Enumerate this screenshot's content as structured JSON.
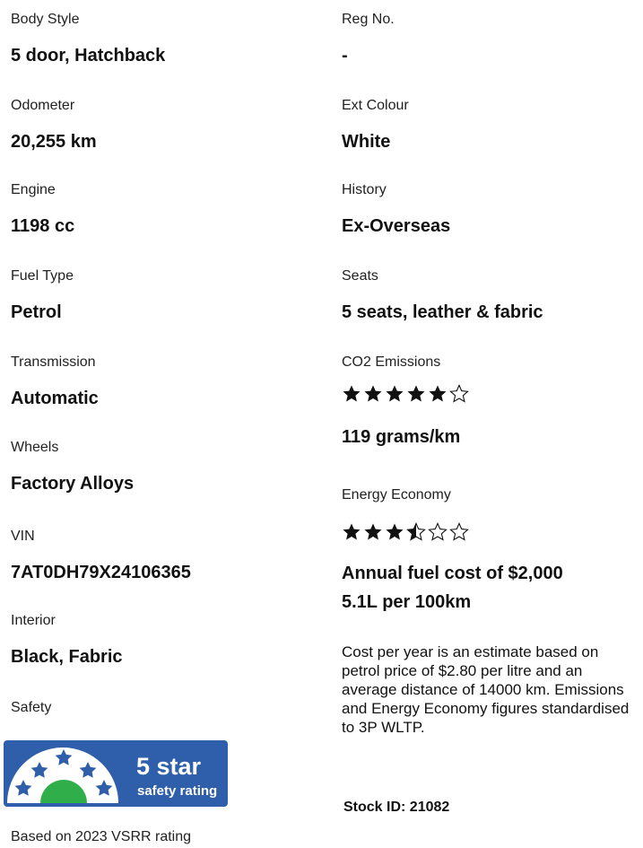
{
  "left": {
    "fields": [
      {
        "label": "Body Style",
        "value": "5 door, Hatchback"
      },
      {
        "label": "Odometer",
        "value": "20,255 km"
      },
      {
        "label": "Engine",
        "value": "1198 cc"
      },
      {
        "label": "Fuel Type",
        "value": "Petrol"
      },
      {
        "label": "Transmission",
        "value": "Automatic"
      },
      {
        "label": "Wheels",
        "value": "Factory Alloys"
      },
      {
        "label": "VIN",
        "value": "7AT0DH79X24106365"
      },
      {
        "label": "Interior",
        "value": "Black, Fabric"
      }
    ],
    "safety_label": "Safety",
    "safety_badge": {
      "stars_text": "5 star",
      "subtitle": "safety rating",
      "rating": 5
    },
    "based_on": "Based on 2023 VSRR rating"
  },
  "right": {
    "fields": [
      {
        "label": "Reg No.",
        "value": "-"
      },
      {
        "label": "Ext Colour",
        "value": "White"
      },
      {
        "label": "History",
        "value": "Ex-Overseas"
      },
      {
        "label": "Seats",
        "value": "5 seats, leather & fabric"
      }
    ],
    "co2": {
      "label": "CO2 Emissions",
      "rating": 5,
      "max": 6,
      "value": "119 grams/km"
    },
    "energy": {
      "label": "Energy Economy",
      "rating": 3.5,
      "max": 6,
      "annual_cost": "Annual fuel cost of $2,000",
      "consumption": "5.1L per 100km"
    },
    "note": "Cost per year is an estimate based on petrol price of  $2.80 per litre and an average distance of 14000 km. Emissions and Energy Economy figures standardised to 3P WLTP.",
    "stock_id": "Stock ID: 21082"
  },
  "colors": {
    "badge_bg": "#2f5eab",
    "badge_star": "#2f5eab",
    "badge_dot": "#2fae4a",
    "text": "#111111"
  }
}
